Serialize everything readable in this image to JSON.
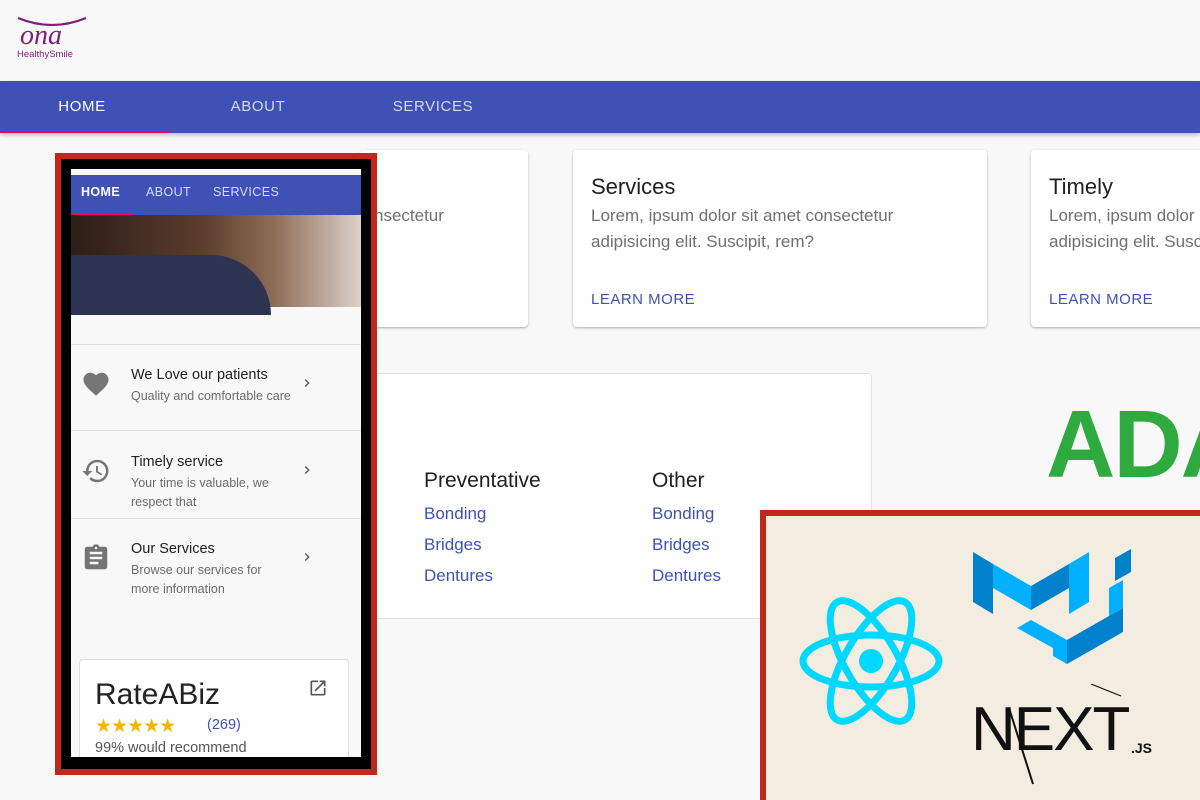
{
  "logo": {
    "mark": "ona",
    "tagline": "HealthySmile"
  },
  "nav": {
    "tabs": [
      "HOME",
      "ABOUT",
      "SERVICES"
    ]
  },
  "cards": [
    {
      "title": "",
      "body": "nsectetur",
      "action": ""
    },
    {
      "title": "Services",
      "body": "Lorem, ipsum dolor sit amet consectetur adipisicing elit. Suscipit, rem?",
      "action": "LEARN MORE"
    },
    {
      "title": "Timely",
      "body": "Lorem, ipsum dolor sit amet consectetur adipisicing elit. Suscipit, rem?",
      "action": "LEARN MORE"
    }
  ],
  "services": [
    {
      "heading": "Preventative",
      "links": [
        "Bonding",
        "Bridges",
        "Dentures"
      ]
    },
    {
      "heading": "Other",
      "links": [
        "Bonding",
        "Bridges",
        "Dentures"
      ]
    }
  ],
  "ada": "ADA",
  "mobile": {
    "tabs": [
      "HOME",
      "ABOUT",
      "SERVICES"
    ],
    "items": [
      {
        "title": "We Love our patients",
        "subtitle": "Quality and comfortable care",
        "icon": "heart-icon"
      },
      {
        "title": "Timely service",
        "subtitle": "Your time is valuable, we respect that",
        "icon": "history-icon"
      },
      {
        "title": "Our Services",
        "subtitle": "Browse our services for more information",
        "icon": "clipboard-icon"
      }
    ],
    "rating": {
      "name": "RateABiz",
      "stars": "★★★★★",
      "count": "(269)",
      "recommend": "99% would recommend",
      "rating_value": 5
    }
  },
  "tech": {
    "next_label": "NEXT",
    "next_suffix": ".JS"
  },
  "colors": {
    "primary": "#3f51b5",
    "accent": "#f50057",
    "ada_green": "#2eaa3e",
    "react_blue": "#00d8ff",
    "mui_blue": "#0081cb",
    "frame_red": "#c0281d"
  }
}
